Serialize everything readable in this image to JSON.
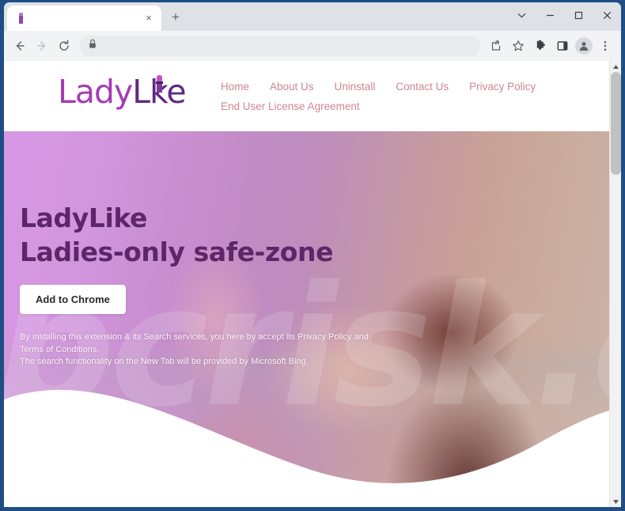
{
  "window": {
    "controls": {
      "tab_search": "tab-search-chevron",
      "minimize": "minimize",
      "maximize": "maximize",
      "close": "close"
    }
  },
  "browser": {
    "tab": {
      "title": "",
      "favicon": "lipstick-icon",
      "close_label": "×"
    },
    "new_tab_label": "+",
    "toolbar": {
      "back": "back-arrow",
      "forward": "forward-arrow",
      "reload": "reload",
      "omnibox_value": "",
      "omnibox_placeholder": "",
      "lock": "lock-icon",
      "share": "share-icon",
      "bookmark": "star-icon",
      "extensions": "puzzle-icon",
      "side_panel": "side-panel-icon",
      "profile": "profile-avatar-icon",
      "menu": "three-dot-menu-icon"
    }
  },
  "site": {
    "logo": {
      "part_1": "Lady",
      "part_2": "L",
      "part_3": "ke",
      "lipstick_icon": "lipstick-icon",
      "color_part_1": "#a63bb5",
      "color_part_2": "#5e2a82"
    },
    "nav": {
      "color": "#d1868f",
      "row_1": [
        {
          "label": "Home"
        },
        {
          "label": "About Us"
        },
        {
          "label": "Uninstall"
        },
        {
          "label": "Contact Us"
        },
        {
          "label": "Privacy Policy"
        }
      ],
      "row_2": [
        {
          "label": "End User License Agreement"
        }
      ]
    },
    "hero": {
      "title_line_1": "LadyLike",
      "title_line_2": "Ladies-only safe-zone",
      "title_color": "#5c2668",
      "cta_label": "Add to Chrome",
      "disclaimer_line_1": "By installing this extension & its Search services, you here by accept its Privacy Policy and Terms of Conditions.",
      "disclaimer_line_2": "The search functionality on the New Tab will be provided by Microsoft Bing.",
      "watermark_text": "pcrisk.com",
      "background_left_color": "#d79ae4",
      "background_right_color": "#cbb6ac"
    }
  },
  "scrollbar": {
    "up_arrow": "scroll-up-arrow",
    "down_arrow": "scroll-down-arrow",
    "thumb": "scroll-thumb"
  }
}
